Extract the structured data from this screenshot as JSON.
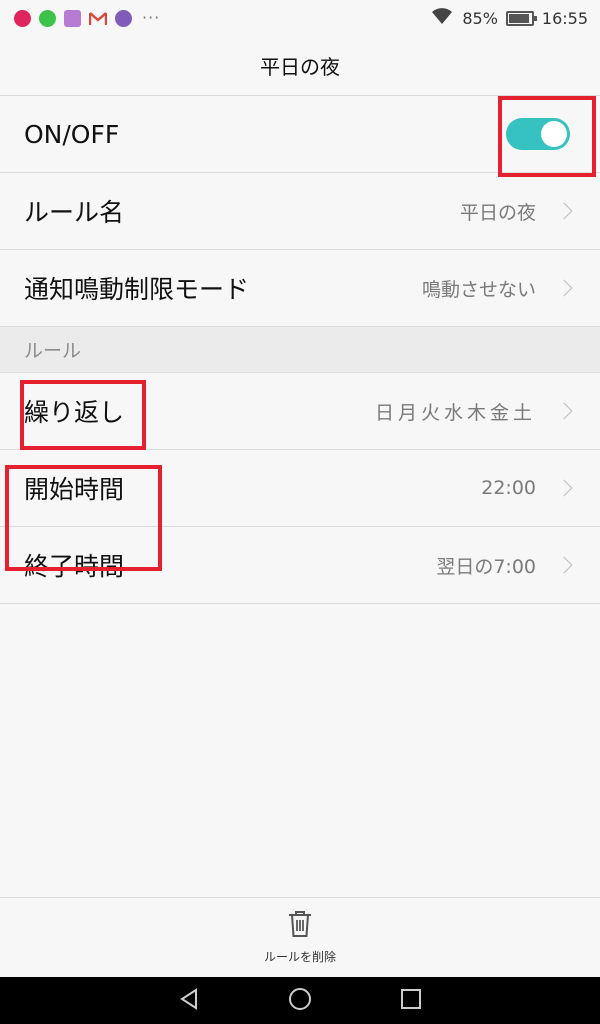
{
  "status_bar": {
    "notification_icons": [
      "pinterest-icon",
      "line-icon",
      "gallery-icon",
      "gmail-icon",
      "app-icon"
    ],
    "more": "···",
    "battery_percent": "85%",
    "time": "16:55"
  },
  "header": {
    "title": "平日の夜"
  },
  "settings": {
    "onoff": {
      "label": "ON/OFF",
      "enabled": true
    },
    "rule_name": {
      "label": "ルール名",
      "value": "平日の夜"
    },
    "mode": {
      "label": "通知鳴動制限モード",
      "value": "鳴動させない"
    }
  },
  "section": {
    "label": "ルール"
  },
  "rules": {
    "repeat": {
      "label": "繰り返し",
      "value": "日月火水木金土"
    },
    "start": {
      "label": "開始時間",
      "value": "22:00"
    },
    "end": {
      "label": "終了時間",
      "value": "翌日の7:00"
    }
  },
  "footer": {
    "delete_label": "ルールを削除"
  },
  "colors": {
    "toggle_on": "#35c2c1",
    "highlight": "#e5202f"
  }
}
